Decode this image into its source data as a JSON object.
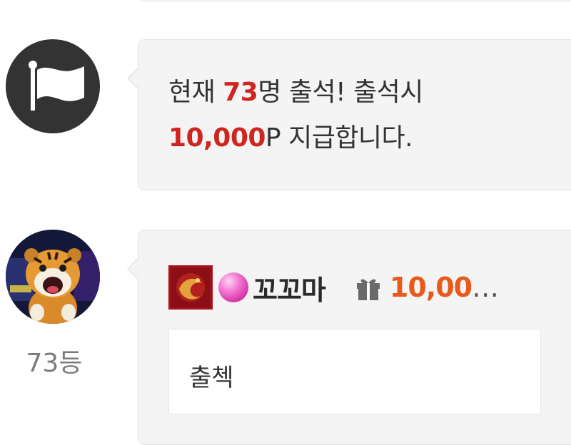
{
  "system_message": {
    "text_1": "현재 ",
    "count": "73",
    "text_2": "명 출석! 출석시",
    "points": "10,000",
    "text_3": "P 지급합니다."
  },
  "comment": {
    "rank": "73등",
    "nickname": "꼬꼬마",
    "gift_amount": "10,00",
    "gift_amount_ellipsis": "…",
    "message": "출첵"
  },
  "colors": {
    "highlight": "#d0251f",
    "gift_amount": "#e8591a",
    "bubble_bg": "#f4f4f4"
  },
  "icons": {
    "system_avatar": "flag-icon",
    "gift": "gift-icon",
    "level": "level-badge-icon",
    "grade": "pink-gem-icon"
  }
}
